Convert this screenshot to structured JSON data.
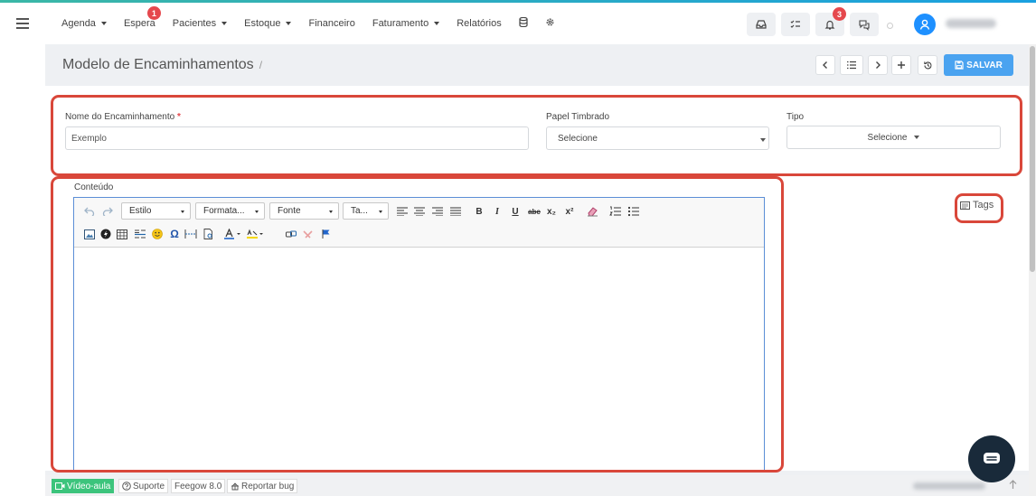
{
  "nav": {
    "items": [
      {
        "label": "Agenda",
        "caret": true
      },
      {
        "label": "Espera",
        "caret": false,
        "badge": "1"
      },
      {
        "label": "Pacientes",
        "caret": true
      },
      {
        "label": "Estoque",
        "caret": true
      },
      {
        "label": "Financeiro",
        "caret": false
      },
      {
        "label": "Faturamento",
        "caret": true
      },
      {
        "label": "Relatórios",
        "caret": false
      }
    ],
    "notification_badge": "3"
  },
  "page": {
    "title": "Modelo de Encaminhamentos",
    "separator": "/",
    "save_label": "SALVAR"
  },
  "form": {
    "name_label": "Nome do Encaminhamento",
    "required_mark": "*",
    "name_value": "Exemplo",
    "letterhead_label": "Papel Timbrado",
    "letterhead_value": "Selecione",
    "type_label": "Tipo",
    "type_value": "Selecione",
    "content_label": "Conteúdo",
    "tags_label": "Tags"
  },
  "editor": {
    "dropdowns": [
      "Estilo",
      "Formata...",
      "Fonte",
      "Ta..."
    ],
    "buttons": {
      "bold": "B",
      "italic": "I",
      "underline": "U",
      "strike": "abc",
      "subscript": "x₂",
      "superscript": "x²",
      "omega": "Ω"
    }
  },
  "footer": {
    "video": "Vídeo-aula",
    "support": "Suporte",
    "version": "Feegow 8.0",
    "bug": "Reportar bug"
  },
  "colors": {
    "accent": "#4aa3f0",
    "highlight": "#d9473a",
    "badge": "#e5484d",
    "video_button": "#3cc47c"
  }
}
